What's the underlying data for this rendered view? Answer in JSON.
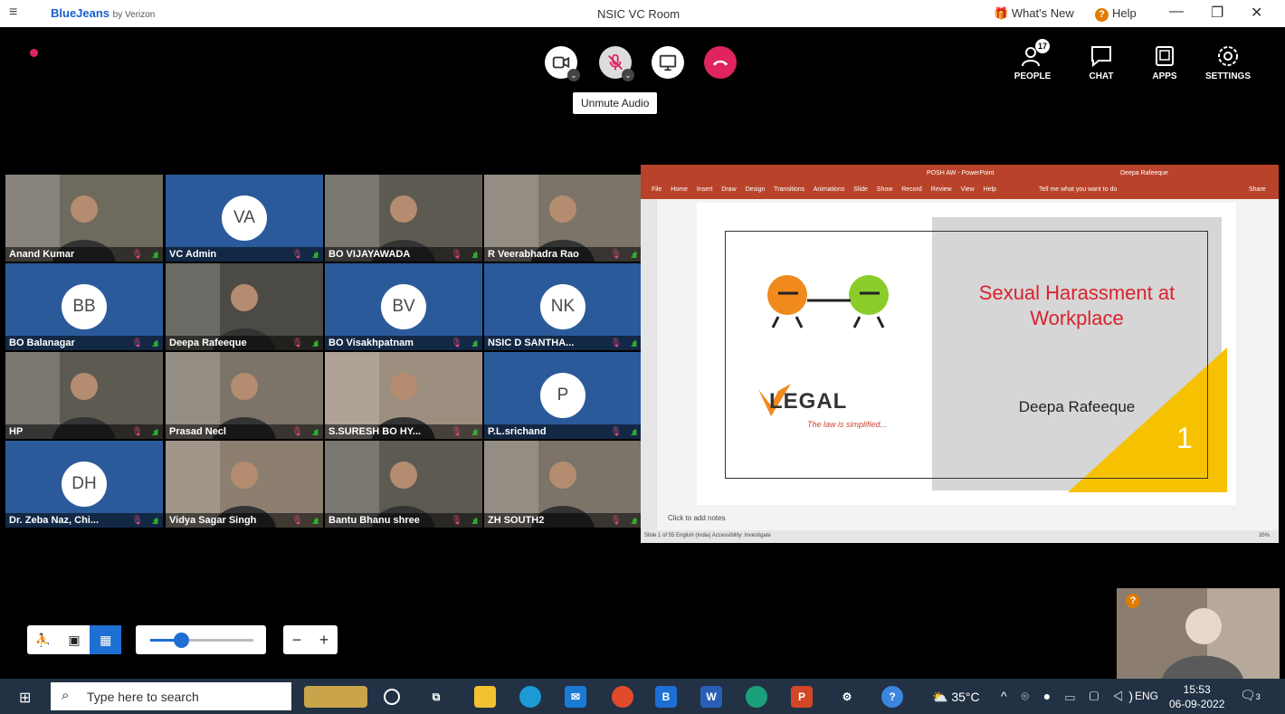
{
  "app": {
    "brand": "BlueJeans",
    "brand_suffix": "by Verizon",
    "room": "NSIC VC Room",
    "whats_new": "What's New",
    "help": "Help"
  },
  "controls": {
    "tooltip": "Unmute Audio"
  },
  "right_nav": {
    "people_label": "PEOPLE",
    "people_count": "17",
    "chat_label": "CHAT",
    "apps_label": "APPS",
    "settings_label": "SETTINGS"
  },
  "participants": [
    {
      "name": "Anand Kumar",
      "initials": "",
      "video": true,
      "active": false
    },
    {
      "name": "VC  Admin",
      "initials": "VA",
      "video": false,
      "active": false
    },
    {
      "name": "BO VIJAYAWADA",
      "initials": "",
      "video": true,
      "active": false
    },
    {
      "name": "R Veerabhadra Rao",
      "initials": "",
      "video": true,
      "active": false
    },
    {
      "name": "BO Balanagar",
      "initials": "BB",
      "video": false,
      "active": false
    },
    {
      "name": "Deepa Rafeeque",
      "initials": "",
      "video": true,
      "active": true
    },
    {
      "name": "BO Visakhpatnam",
      "initials": "BV",
      "video": false,
      "active": false
    },
    {
      "name": "NSIC D SANTHA...",
      "initials": "NK",
      "video": false,
      "active": false
    },
    {
      "name": "HP",
      "initials": "",
      "video": true,
      "active": false
    },
    {
      "name": "Prasad Necl",
      "initials": "",
      "video": true,
      "active": false
    },
    {
      "name": "S.SURESH BO HY...",
      "initials": "",
      "video": true,
      "active": false
    },
    {
      "name": "P.L.srichand",
      "initials": "P",
      "video": false,
      "active": false
    },
    {
      "name": "Dr. Zeba Naz, Chi...",
      "initials": "DH",
      "video": false,
      "active": false
    },
    {
      "name": "Vidya Sagar Singh",
      "initials": "",
      "video": true,
      "active": false
    },
    {
      "name": "Bantu Bhanu shree",
      "initials": "",
      "video": true,
      "active": false
    },
    {
      "name": "ZH SOUTH2",
      "initials": "",
      "video": true,
      "active": false
    }
  ],
  "presentation": {
    "window_title": "POSH AW - PowerPoint",
    "user": "Deepa Rafeeque",
    "ribbon_tabs": "File Home Insert Draw Design Transitions Animations Slide Show Record Review View Help",
    "tell_me": "Tell me what you want to do",
    "share": "Share",
    "slide_title": "Sexual Harassment at Workplace",
    "slide_presenter": "Deepa Rafeeque",
    "slide_number": "1",
    "logo_text": "LEGAL",
    "logo_tagline": "The law is simplified...",
    "notes_placeholder": "Click to add notes",
    "status": "Slide 1 of 55   English (India)   Accessibility: Investigate",
    "zoom": "35%"
  },
  "selfview": {
    "badge": "?"
  },
  "zoom_slider": {
    "value": 0.3
  },
  "taskbar": {
    "search_placeholder": "Type here to search",
    "weather": "35°C",
    "lang": "ENG",
    "time": "15:53",
    "date": "06-09-2022",
    "notif_count": "3"
  }
}
